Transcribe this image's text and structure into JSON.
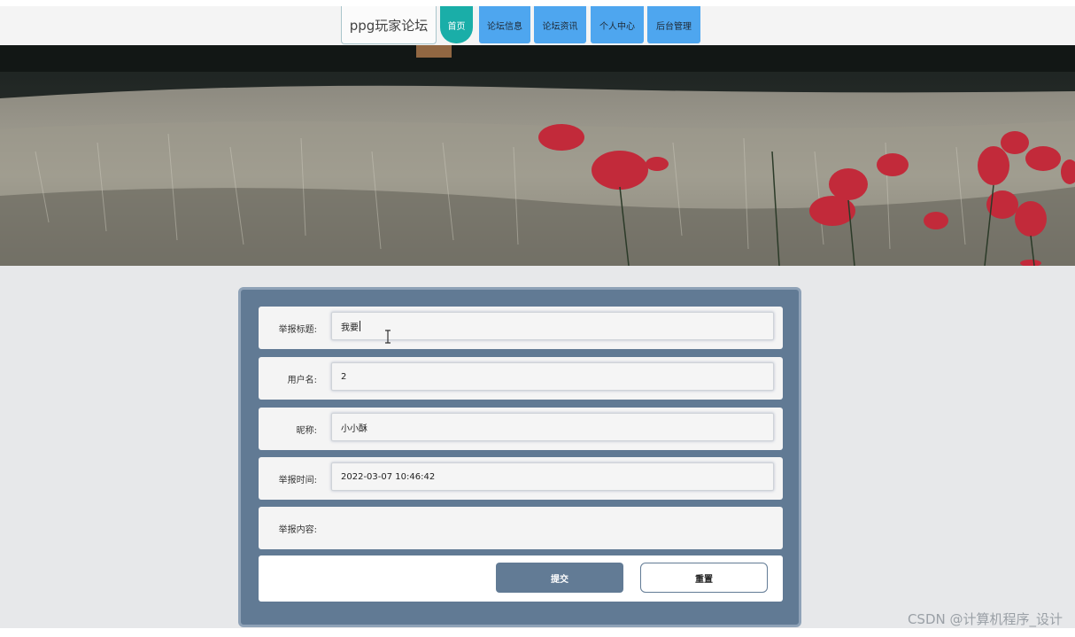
{
  "nav": {
    "brand": "ppg玩家论坛",
    "items": [
      {
        "label": "首页",
        "active": true
      },
      {
        "label": "论坛信息",
        "active": false
      },
      {
        "label": "论坛资讯",
        "active": false
      },
      {
        "label": "个人中心",
        "active": false
      },
      {
        "label": "后台管理",
        "active": false
      }
    ]
  },
  "banner": {
    "image": "poppy-wheat-field-photo"
  },
  "form": {
    "report_title": {
      "label": "举报标题:",
      "value": "我要"
    },
    "username": {
      "label": "用户名:",
      "value": "2"
    },
    "nickname": {
      "label": "昵称:",
      "value": "小小酥"
    },
    "report_time": {
      "label": "举报时间:",
      "value": "2022-03-07 10:46:42"
    },
    "report_content": {
      "label": "举报内容:",
      "value": ""
    },
    "submit_label": "提交",
    "reset_label": "重置"
  },
  "colors": {
    "nav_active": "#1aaea8",
    "nav_button": "#4ea6ef",
    "form_panel": "#617a94",
    "submit_button": "#627b95"
  },
  "watermark": "CSDN @计算机程序_设计"
}
